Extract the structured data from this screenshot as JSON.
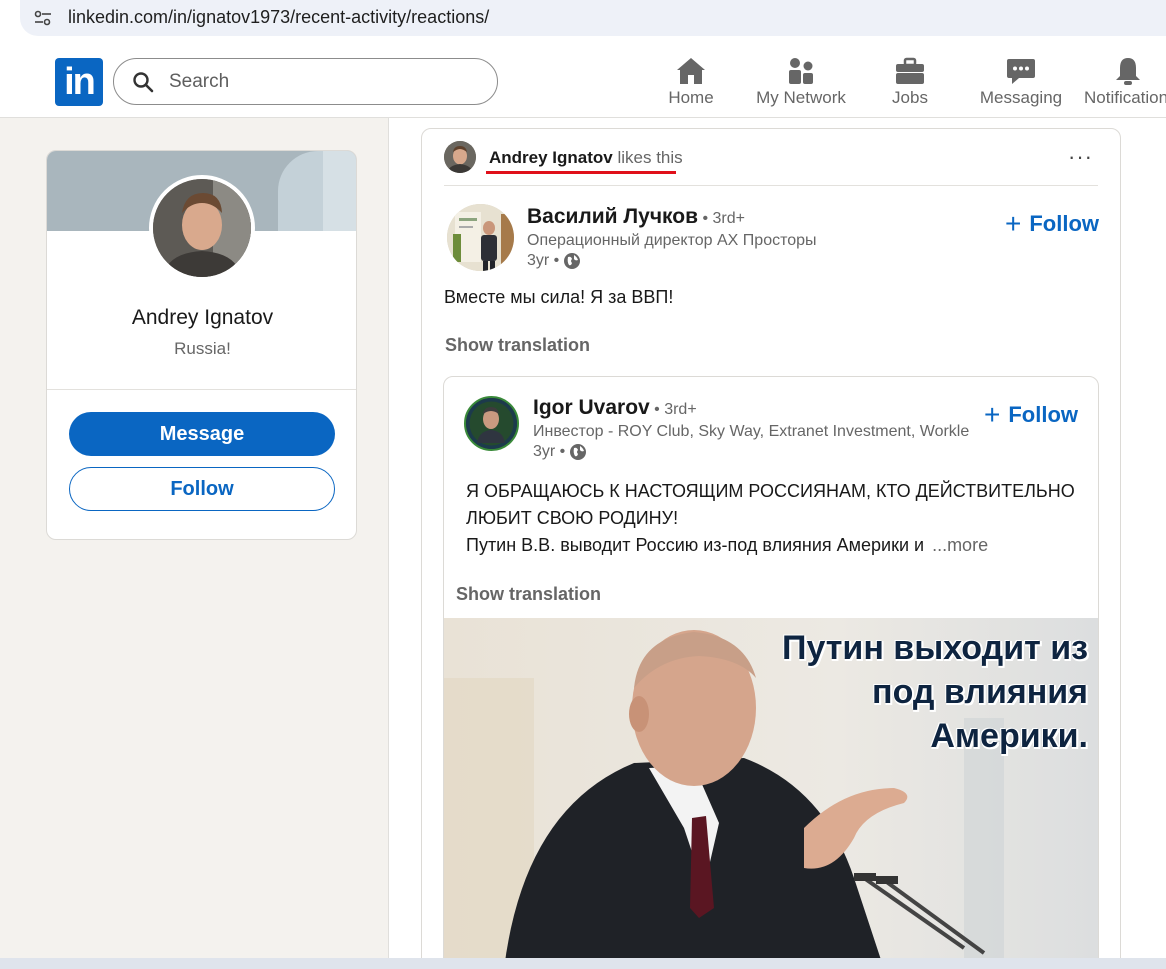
{
  "browser": {
    "url": "linkedin.com/in/ignatov1973/recent-activity/reactions/"
  },
  "nav": {
    "logo": "in",
    "search_placeholder": "Search",
    "items": [
      {
        "label": "Home",
        "icon": "home-icon"
      },
      {
        "label": "My Network",
        "icon": "network-icon"
      },
      {
        "label": "Jobs",
        "icon": "briefcase-icon"
      },
      {
        "label": "Messaging",
        "icon": "messaging-icon"
      },
      {
        "label": "Notifications",
        "icon": "bell-icon"
      }
    ]
  },
  "profile": {
    "name": "Andrey Ignatov",
    "headline": "Russia!",
    "message_label": "Message",
    "follow_label": "Follow"
  },
  "activity": {
    "actor": "Andrey Ignatov",
    "action": " likes this",
    "more": "···"
  },
  "post": {
    "author": "Василий Лучков",
    "degree": " • 3rd+",
    "headline": "Операционный директор АХ Просторы",
    "time": "3yr •",
    "follow_label": "Follow",
    "text": "Вместе мы сила! Я за ВВП!",
    "show_translation": "Show translation"
  },
  "reshare": {
    "author": "Igor Uvarov",
    "degree": " • 3rd+",
    "headline": "Инвестор - ROY Club, Sky Way, Extranet Investment, Workle",
    "time": "3yr •",
    "follow_label": "Follow",
    "body_line1": "Я ОБРАЩАЮСЬ К НАСТОЯЩИМ РОССИЯНАМ, КТО ДЕЙСТВИТЕЛЬНО",
    "body_line2": "ЛЮБИТ СВОЮ РОДИНУ!",
    "body_line3": "Путин В.В. выводит Россию из-под влияния Америки и",
    "more": "...more",
    "show_translation": "Show translation",
    "image_caption": [
      "Путин выходит из",
      "под влияния",
      "Америки."
    ]
  },
  "colors": {
    "brand": "#0a66c2",
    "underline": "#e0101a"
  }
}
